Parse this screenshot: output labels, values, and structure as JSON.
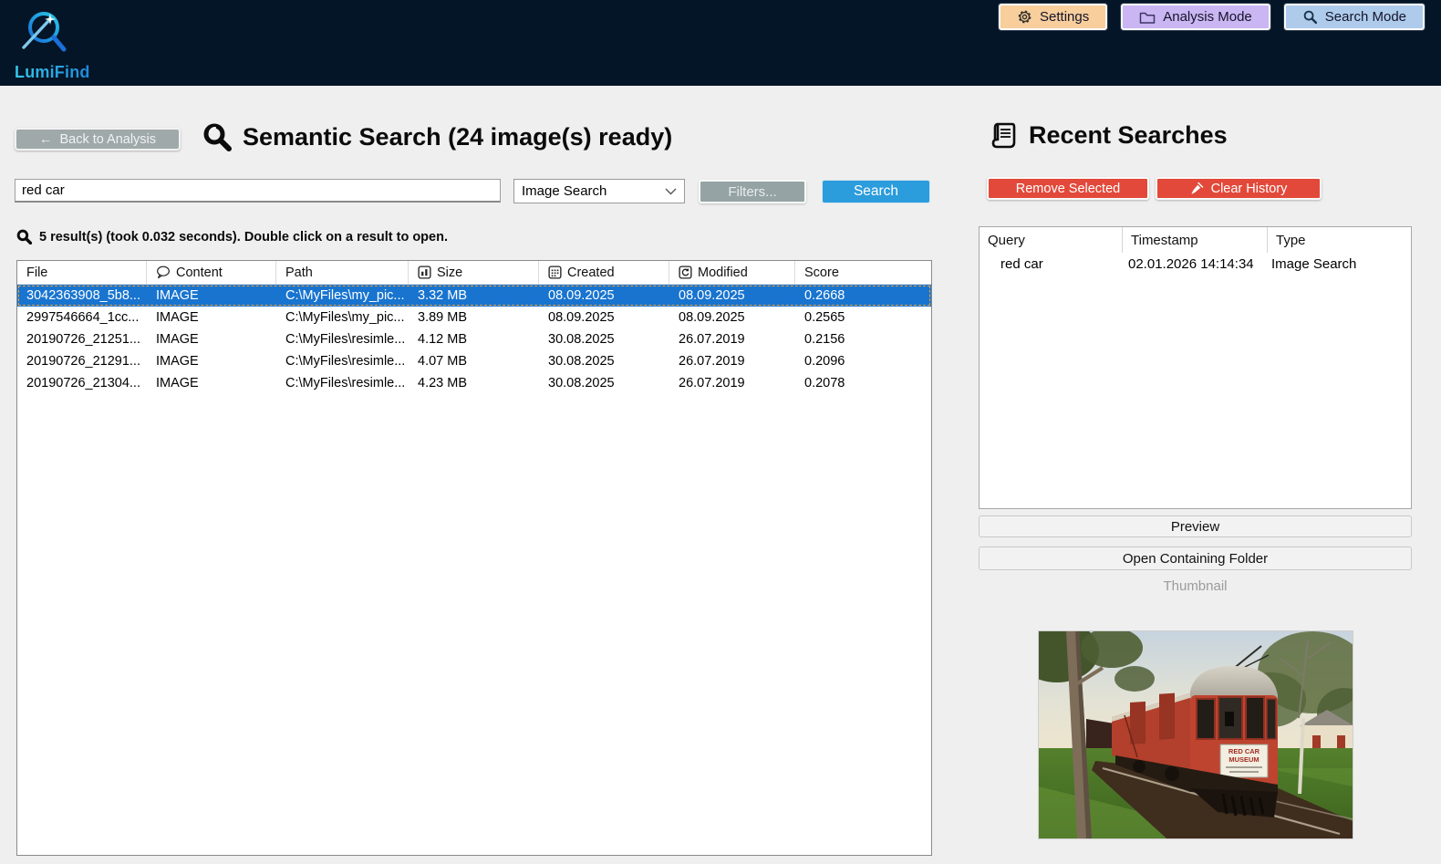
{
  "topbar": {
    "logo_text": "LumiFind",
    "settings_label": "Settings",
    "analysis_label": "Analysis Mode",
    "searchmode_label": "Search Mode"
  },
  "search": {
    "back_arrow": "←",
    "back_label": "Back to Analysis",
    "title": "Semantic Search (24 image(s) ready)",
    "query": "red car",
    "mode": "Image Search",
    "filters_label": "Filters...",
    "search_label": "Search",
    "summary": "5 result(s) (took 0.032 seconds). Double click on a result to open.",
    "columns": [
      "File",
      "Content",
      "Path",
      "Size",
      "Created",
      "Modified",
      "Score"
    ],
    "rows": [
      {
        "file": "3042363908_5b8...",
        "content": "IMAGE",
        "path": "C:\\MyFiles\\my_pic...",
        "size": "3.32 MB",
        "created": "08.09.2025",
        "modified": "08.09.2025",
        "score": "0.2668"
      },
      {
        "file": "2997546664_1cc...",
        "content": "IMAGE",
        "path": "C:\\MyFiles\\my_pic...",
        "size": "3.89 MB",
        "created": "08.09.2025",
        "modified": "08.09.2025",
        "score": "0.2565"
      },
      {
        "file": "20190726_21251...",
        "content": "IMAGE",
        "path": "C:\\MyFiles\\resimle...",
        "size": "4.12 MB",
        "created": "30.08.2025",
        "modified": "26.07.2019",
        "score": "0.2156"
      },
      {
        "file": "20190726_21291...",
        "content": "IMAGE",
        "path": "C:\\MyFiles\\resimle...",
        "size": "4.07 MB",
        "created": "30.08.2025",
        "modified": "26.07.2019",
        "score": "0.2096"
      },
      {
        "file": "20190726_21304...",
        "content": "IMAGE",
        "path": "C:\\MyFiles\\resimle...",
        "size": "4.23 MB",
        "created": "30.08.2025",
        "modified": "26.07.2019",
        "score": "0.2078"
      }
    ]
  },
  "recent": {
    "title": "Recent Searches",
    "remove_label": "Remove Selected",
    "clear_label": "Clear History",
    "columns": [
      "Query",
      "Timestamp",
      "Type"
    ],
    "rows": [
      {
        "query": "red car",
        "timestamp": "02.01.2026 14:14:34",
        "type": "Image Search"
      }
    ],
    "preview_label": "Preview",
    "openfolder_label": "Open Containing Folder",
    "thumbnail_label": "Thumbnail",
    "thumbnail_sign_line1": "RED CAR",
    "thumbnail_sign_line2": "MUSEUM"
  },
  "colors": {
    "topbar_bg": "#041527",
    "accent_blue": "#2b9cdc",
    "selected_row": "#1874cf",
    "danger_red": "#e2493a",
    "settings_bg": "#f7ce9c",
    "analysis_bg": "#c9b6f2",
    "searchmode_bg": "#aecbeb",
    "logo_cyan": "#35c8e8"
  }
}
